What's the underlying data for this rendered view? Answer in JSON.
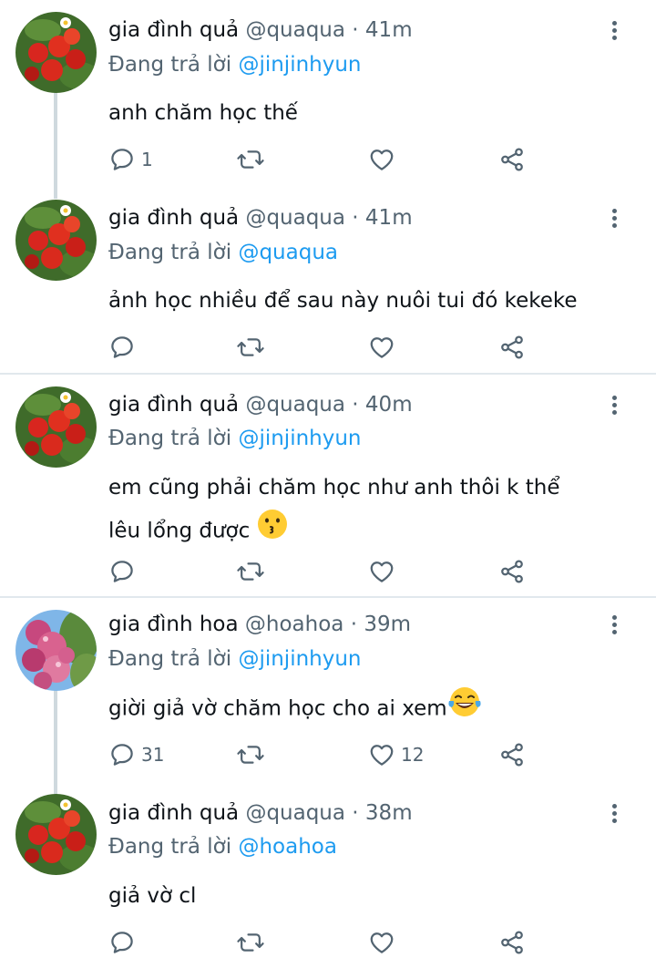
{
  "tweets": [
    {
      "name": "gia đình quả",
      "handle": "@quaqua",
      "time": "41m",
      "reply_prefix": "Đang trả lời",
      "reply_to": "@jinjinhyun",
      "text_lines": [
        "anh chăm học thế"
      ],
      "emoji": "",
      "avatar": "strawberry-avatar",
      "counts": {
        "reply": "1",
        "retweet": "",
        "like": ""
      }
    },
    {
      "name": "gia đình quả",
      "handle": "@quaqua",
      "time": "41m",
      "reply_prefix": "Đang trả lời",
      "reply_to": "@quaqua",
      "text_lines": [
        "ảnh học nhiều để sau này nuôi tui đó kekeke"
      ],
      "emoji": "",
      "avatar": "strawberry-avatar",
      "counts": {
        "reply": "",
        "retweet": "",
        "like": ""
      }
    },
    {
      "name": "gia đình quả",
      "handle": "@quaqua",
      "time": "40m",
      "reply_prefix": "Đang trả lời",
      "reply_to": "@jinjinhyun",
      "text_lines": [
        "em cũng phải chăm học như anh thôi k thể",
        "lêu lổng được"
      ],
      "emoji": "kissing-face",
      "avatar": "strawberry-avatar",
      "counts": {
        "reply": "",
        "retweet": "",
        "like": ""
      }
    },
    {
      "name": "gia đình hoa",
      "handle": "@hoahoa",
      "time": "39m",
      "reply_prefix": "Đang trả lời",
      "reply_to": "@jinjinhyun",
      "text_lines": [
        "giời giả vờ chăm học cho ai xem"
      ],
      "emoji": "tears-of-joy",
      "avatar": "flower-avatar",
      "counts": {
        "reply": "31",
        "retweet": "",
        "like": "12"
      }
    },
    {
      "name": "gia đình quả",
      "handle": "@quaqua",
      "time": "38m",
      "reply_prefix": "Đang trả lời",
      "reply_to": "@hoahoa",
      "text_lines": [
        "giả vờ cl"
      ],
      "emoji": "",
      "avatar": "strawberry-avatar",
      "counts": {
        "reply": "",
        "retweet": "",
        "like": ""
      }
    }
  ],
  "separator": "·",
  "colors": {
    "mention": "#1d9bf0",
    "secondary": "#536471",
    "text": "#0f1419",
    "divider": "#e1e8ed"
  },
  "icons": [
    "reply-icon",
    "retweet-icon",
    "like-icon",
    "share-icon",
    "more-icon"
  ]
}
